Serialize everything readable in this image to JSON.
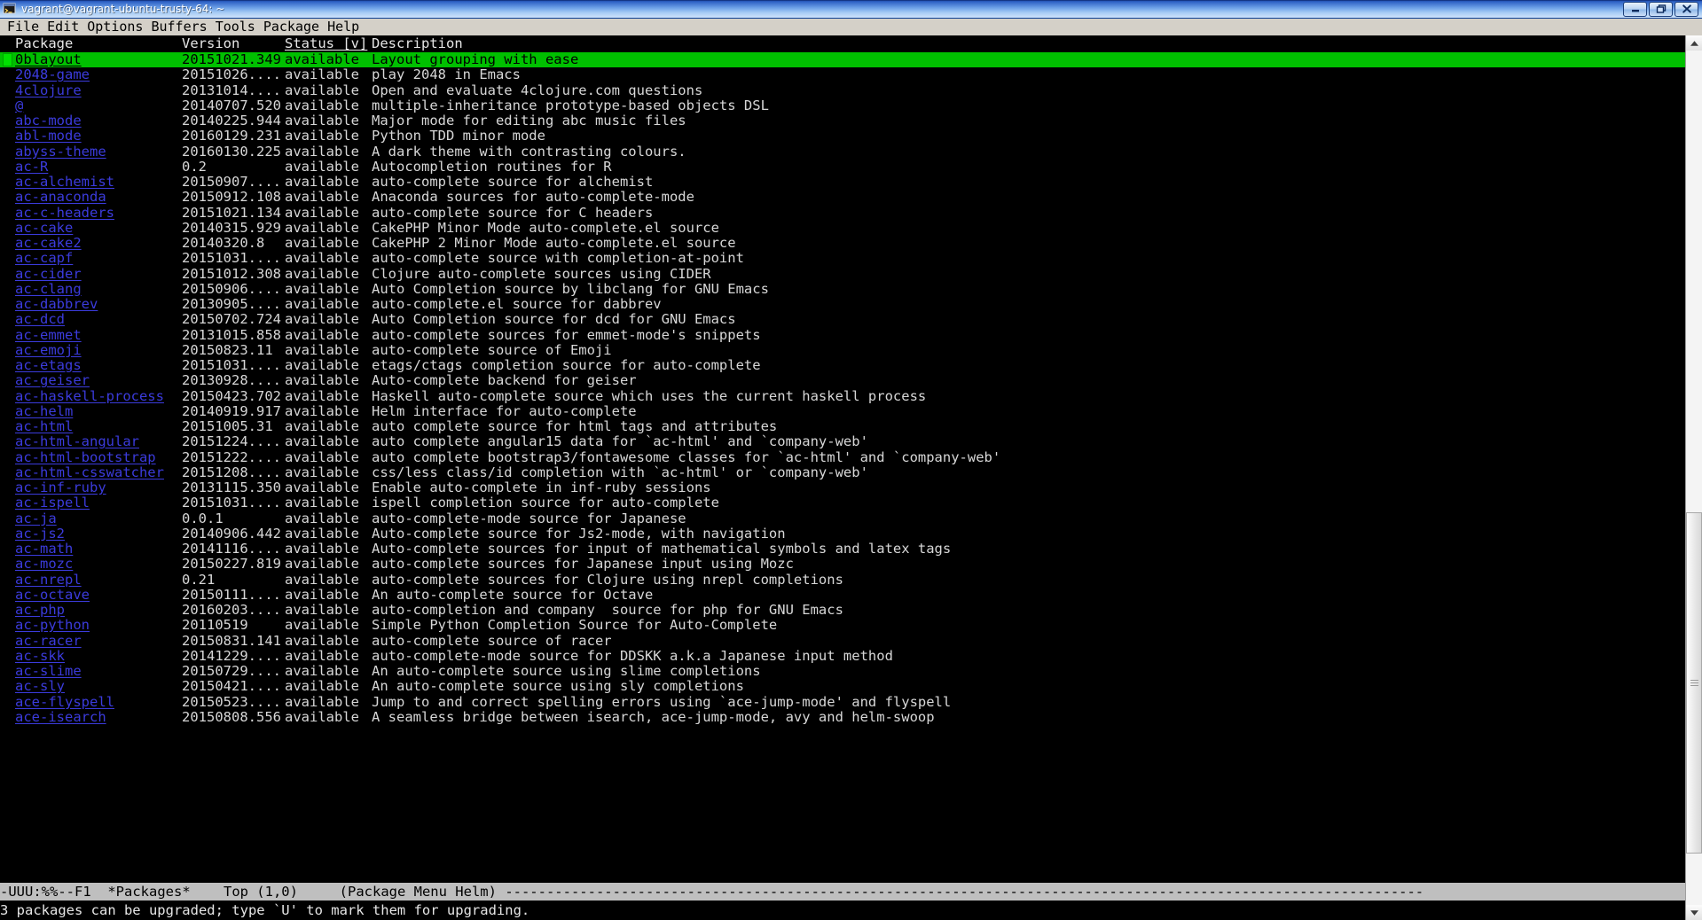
{
  "titlebar": {
    "title": "vagrant@vagrant-ubuntu-trusty-64: ~",
    "icon": "terminal-icon",
    "minimize_label": "–",
    "restore_label": "□",
    "close_label": "✕"
  },
  "menubar": {
    "items": [
      {
        "label": "File"
      },
      {
        "label": "Edit"
      },
      {
        "label": "Options"
      },
      {
        "label": "Buffers"
      },
      {
        "label": "Tools"
      },
      {
        "label": "Package"
      },
      {
        "label": "Help"
      }
    ]
  },
  "colors": {
    "background": "#000000",
    "foreground": "#d7d7d7",
    "link": "#3b3bdc",
    "selection": "#00c000",
    "cursor": "#00e000",
    "modeline_bg": "#bfbfbf",
    "modeline_fg": "#000000",
    "menubar_bg": "#d4d0c8"
  },
  "table": {
    "columns": [
      {
        "key": "name",
        "label": "Package"
      },
      {
        "key": "version",
        "label": "Version"
      },
      {
        "key": "status",
        "label": "Status [v]"
      },
      {
        "key": "desc",
        "label": "Description"
      }
    ],
    "sort_column": "Status [v]",
    "selected_index": 0,
    "rows": [
      {
        "name": "0blayout",
        "version": "20151021.349",
        "status": "available",
        "desc": "Layout grouping with ease"
      },
      {
        "name": "2048-game",
        "version": "20151026....",
        "status": "available",
        "desc": "play 2048 in Emacs"
      },
      {
        "name": "4clojure",
        "version": "20131014....",
        "status": "available",
        "desc": "Open and evaluate 4clojure.com questions"
      },
      {
        "name": "@",
        "version": "20140707.520",
        "status": "available",
        "desc": "multiple-inheritance prototype-based objects DSL"
      },
      {
        "name": "abc-mode",
        "version": "20140225.944",
        "status": "available",
        "desc": "Major mode for editing abc music files"
      },
      {
        "name": "abl-mode",
        "version": "20160129.231",
        "status": "available",
        "desc": "Python TDD minor mode"
      },
      {
        "name": "abyss-theme",
        "version": "20160130.225",
        "status": "available",
        "desc": "A dark theme with contrasting colours."
      },
      {
        "name": "ac-R",
        "version": "0.2",
        "status": "available",
        "desc": "Autocompletion routines for R"
      },
      {
        "name": "ac-alchemist",
        "version": "20150907....",
        "status": "available",
        "desc": "auto-complete source for alchemist"
      },
      {
        "name": "ac-anaconda",
        "version": "20150912.108",
        "status": "available",
        "desc": "Anaconda sources for auto-complete-mode"
      },
      {
        "name": "ac-c-headers",
        "version": "20151021.134",
        "status": "available",
        "desc": "auto-complete source for C headers"
      },
      {
        "name": "ac-cake",
        "version": "20140315.929",
        "status": "available",
        "desc": "CakePHP Minor Mode auto-complete.el source"
      },
      {
        "name": "ac-cake2",
        "version": "20140320.8",
        "status": "available",
        "desc": "CakePHP 2 Minor Mode auto-complete.el source"
      },
      {
        "name": "ac-capf",
        "version": "20151031....",
        "status": "available",
        "desc": "auto-complete source with completion-at-point"
      },
      {
        "name": "ac-cider",
        "version": "20151012.308",
        "status": "available",
        "desc": "Clojure auto-complete sources using CIDER"
      },
      {
        "name": "ac-clang",
        "version": "20150906....",
        "status": "available",
        "desc": "Auto Completion source by libclang for GNU Emacs"
      },
      {
        "name": "ac-dabbrev",
        "version": "20130905....",
        "status": "available",
        "desc": "auto-complete.el source for dabbrev"
      },
      {
        "name": "ac-dcd",
        "version": "20150702.724",
        "status": "available",
        "desc": "Auto Completion source for dcd for GNU Emacs"
      },
      {
        "name": "ac-emmet",
        "version": "20131015.858",
        "status": "available",
        "desc": "auto-complete sources for emmet-mode's snippets"
      },
      {
        "name": "ac-emoji",
        "version": "20150823.11",
        "status": "available",
        "desc": "auto-complete source of Emoji"
      },
      {
        "name": "ac-etags",
        "version": "20151031....",
        "status": "available",
        "desc": "etags/ctags completion source for auto-complete"
      },
      {
        "name": "ac-geiser",
        "version": "20130928....",
        "status": "available",
        "desc": "Auto-complete backend for geiser"
      },
      {
        "name": "ac-haskell-process",
        "version": "20150423.702",
        "status": "available",
        "desc": "Haskell auto-complete source which uses the current haskell process"
      },
      {
        "name": "ac-helm",
        "version": "20140919.917",
        "status": "available",
        "desc": "Helm interface for auto-complete"
      },
      {
        "name": "ac-html",
        "version": "20151005.31",
        "status": "available",
        "desc": "auto complete source for html tags and attributes"
      },
      {
        "name": "ac-html-angular",
        "version": "20151224....",
        "status": "available",
        "desc": "auto complete angular15 data for `ac-html' and `company-web'"
      },
      {
        "name": "ac-html-bootstrap",
        "version": "20151222....",
        "status": "available",
        "desc": "auto complete bootstrap3/fontawesome classes for `ac-html' and `company-web'"
      },
      {
        "name": "ac-html-csswatcher",
        "version": "20151208....",
        "status": "available",
        "desc": "css/less class/id completion with `ac-html' or `company-web'"
      },
      {
        "name": "ac-inf-ruby",
        "version": "20131115.350",
        "status": "available",
        "desc": "Enable auto-complete in inf-ruby sessions"
      },
      {
        "name": "ac-ispell",
        "version": "20151031....",
        "status": "available",
        "desc": "ispell completion source for auto-complete"
      },
      {
        "name": "ac-ja",
        "version": "0.0.1",
        "status": "available",
        "desc": "auto-complete-mode source for Japanese"
      },
      {
        "name": "ac-js2",
        "version": "20140906.442",
        "status": "available",
        "desc": "Auto-complete source for Js2-mode, with navigation"
      },
      {
        "name": "ac-math",
        "version": "20141116....",
        "status": "available",
        "desc": "Auto-complete sources for input of mathematical symbols and latex tags"
      },
      {
        "name": "ac-mozc",
        "version": "20150227.819",
        "status": "available",
        "desc": "auto-complete sources for Japanese input using Mozc"
      },
      {
        "name": "ac-nrepl",
        "version": "0.21",
        "status": "available",
        "desc": "auto-complete sources for Clojure using nrepl completions"
      },
      {
        "name": "ac-octave",
        "version": "20150111....",
        "status": "available",
        "desc": "An auto-complete source for Octave"
      },
      {
        "name": "ac-php",
        "version": "20160203....",
        "status": "available",
        "desc": "auto-completion and company  source for php for GNU Emacs"
      },
      {
        "name": "ac-python",
        "version": "20110519",
        "status": "available",
        "desc": "Simple Python Completion Source for Auto-Complete"
      },
      {
        "name": "ac-racer",
        "version": "20150831.141",
        "status": "available",
        "desc": "auto-complete source of racer"
      },
      {
        "name": "ac-skk",
        "version": "20141229....",
        "status": "available",
        "desc": "auto-complete-mode source for DDSKK a.k.a Japanese input method"
      },
      {
        "name": "ac-slime",
        "version": "20150729....",
        "status": "available",
        "desc": "An auto-complete source using slime completions"
      },
      {
        "name": "ac-sly",
        "version": "20150421....",
        "status": "available",
        "desc": "An auto-complete source using sly completions"
      },
      {
        "name": "ace-flyspell",
        "version": "20150523....",
        "status": "available",
        "desc": "Jump to and correct spelling errors using `ace-jump-mode' and flyspell"
      },
      {
        "name": "ace-isearch",
        "version": "20150808.556",
        "status": "available",
        "desc": "A seamless bridge between isearch, ace-jump-mode, avy and helm-swoop"
      }
    ]
  },
  "modeline": {
    "flags": "-UUU:%%--F1",
    "buffer_name": "*Packages*",
    "position": "Top (1,0)",
    "major_mode": "(Package Menu Helm)",
    "filler": "---------------------------------------------------------------------------------------------------------------"
  },
  "echo_area": {
    "message": "3 packages can be upgraded; type `U' to mark them for upgrading."
  },
  "scrollbar": {
    "up_arrow": "scroll-up-arrow-icon",
    "down_arrow": "scroll-down-arrow-icon",
    "thumb": "scroll-thumb"
  }
}
